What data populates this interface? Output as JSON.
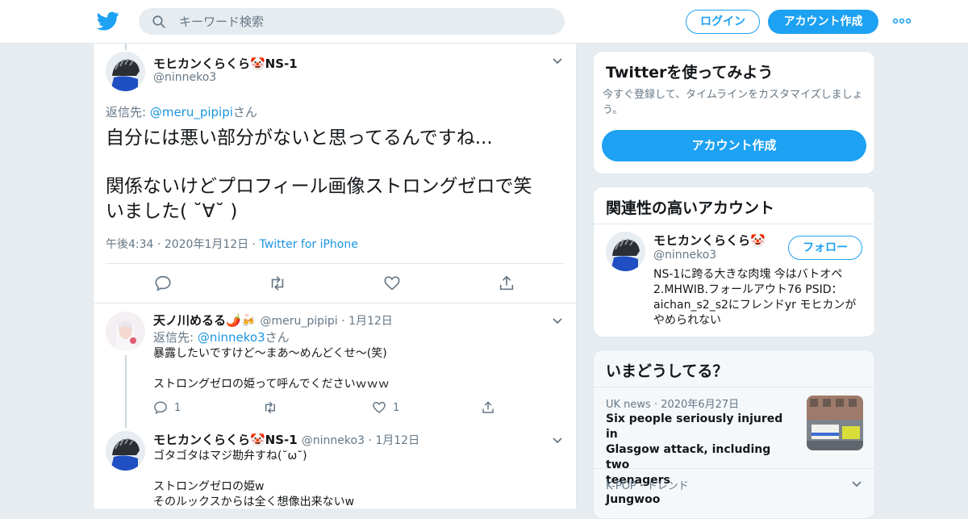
{
  "header": {
    "search_placeholder": "キーワード検索",
    "login_label": "ログイン",
    "signup_label": "アカウント作成"
  },
  "main_tweet": {
    "name": "モヒカンくらくら🤡NS-1",
    "handle": "@ninneko3",
    "reply_prefix": "返信先: ",
    "reply_to": "@meru_pipipi",
    "reply_suffix": "さん",
    "text_line1": "自分には悪い部分がないと思ってるんですね...",
    "text_line2": "関係ないけどプロフィール画像ストロングゼロで笑",
    "text_line3": "いました( ˘∀˘ )",
    "time": "午後4:34",
    "date": "2020年1月12日",
    "source": "Twitter for iPhone"
  },
  "replies": [
    {
      "name": "天ノ川めるる🌶️🍻",
      "handle": "@meru_pipipi",
      "date": "1月12日",
      "reply_prefix": "返信先: ",
      "reply_to": "@ninneko3",
      "reply_suffix": "さん",
      "line1": "暴露したいですけど～まあ～めんどくせ～(笑)",
      "line2": "ストロングゼロの姫って呼んでくださいｗｗｗ",
      "reply_count": "1",
      "like_count": "1"
    },
    {
      "name": "モヒカンくらくら🤡NS-1",
      "handle": "@ninneko3",
      "date": "1月12日",
      "line1": "ゴタゴタはマジ勘弁すね(˘ω˘)",
      "line2": "ストロングゼロの姫w",
      "line3": "そのルックスからは全く想像出来ないw"
    }
  ],
  "signup_card": {
    "title": "Twitterを使ってみよう",
    "desc_line1": "今すぐ登録して、タイムラインをカスタマイズしましょ",
    "desc_line2": "う。",
    "button": "アカウント作成"
  },
  "related_card": {
    "title": "関連性の高いアカウント",
    "name": "モヒカンくらくら🤡",
    "handle": "@ninneko3",
    "follow_label": "フォロー",
    "bio_line1": "NS-1に跨る大きな肉塊 今はバトオペ",
    "bio_line2": "2.MHWIB.フォールアウト76 PSID：",
    "bio_line3": "aichan_s2_s2にフレンドyr モヒカンが",
    "bio_line4": "やめられない"
  },
  "trends_card": {
    "title": "いまどうしてる？",
    "items": [
      {
        "category": "UK news",
        "date": "2020年6月27日",
        "line1": "Six people seriously injured in",
        "line2": "Glasgow attack, including two",
        "line3": "teenagers"
      },
      {
        "category": "K-POP・トレンド",
        "title": "Jungwoo"
      }
    ]
  },
  "colors": {
    "accent": "#1da1f2",
    "link": "#1b95e0",
    "muted": "#657786",
    "background": "#e6ecf0"
  }
}
